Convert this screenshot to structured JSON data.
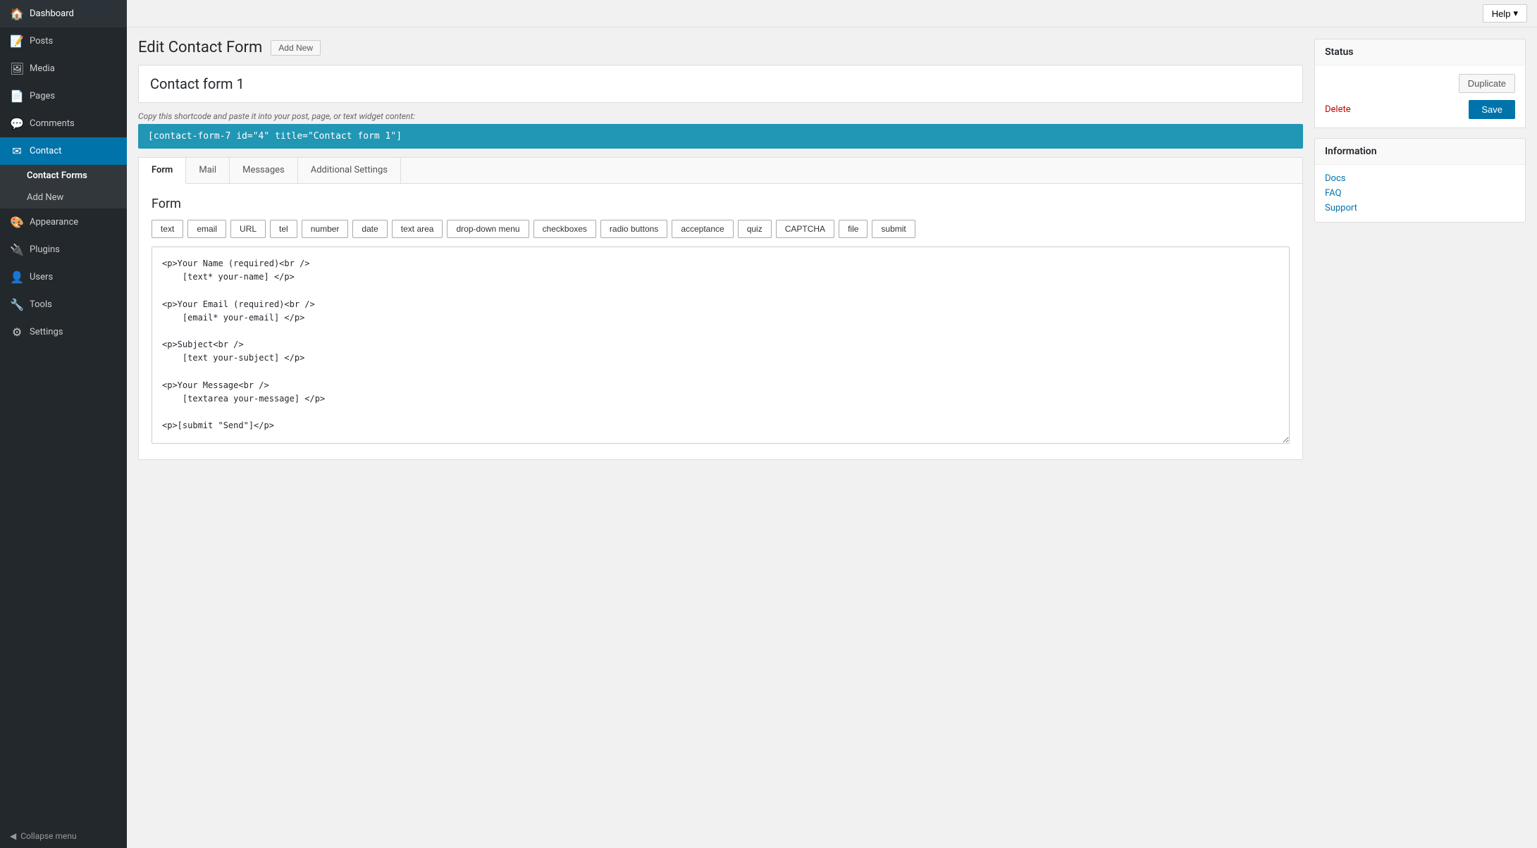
{
  "sidebar": {
    "items": [
      {
        "id": "dashboard",
        "label": "Dashboard",
        "icon": "🏠"
      },
      {
        "id": "posts",
        "label": "Posts",
        "icon": "📝"
      },
      {
        "id": "media",
        "label": "Media",
        "icon": "🖼"
      },
      {
        "id": "pages",
        "label": "Pages",
        "icon": "📄"
      },
      {
        "id": "comments",
        "label": "Comments",
        "icon": "💬"
      },
      {
        "id": "contact",
        "label": "Contact",
        "icon": "✉",
        "active": true
      },
      {
        "id": "appearance",
        "label": "Appearance",
        "icon": "🎨"
      },
      {
        "id": "plugins",
        "label": "Plugins",
        "icon": "🔌"
      },
      {
        "id": "users",
        "label": "Users",
        "icon": "👤"
      },
      {
        "id": "tools",
        "label": "Tools",
        "icon": "🔧"
      },
      {
        "id": "settings",
        "label": "Settings",
        "icon": "⚙"
      }
    ],
    "contact_submenu": [
      {
        "id": "contact-forms",
        "label": "Contact Forms",
        "active": true
      },
      {
        "id": "add-new",
        "label": "Add New"
      }
    ],
    "collapse_label": "Collapse menu"
  },
  "topbar": {
    "help_label": "Help",
    "help_arrow": "▾"
  },
  "page": {
    "title": "Edit Contact Form",
    "add_new_label": "Add New",
    "form_name": "Contact form 1",
    "shortcode_desc": "Copy this shortcode and paste it into your post, page, or text widget content:",
    "shortcode": "[contact-form-7 id=\"4\" title=\"Contact form 1\"]"
  },
  "tabs": [
    {
      "id": "form",
      "label": "Form",
      "active": true
    },
    {
      "id": "mail",
      "label": "Mail"
    },
    {
      "id": "messages",
      "label": "Messages"
    },
    {
      "id": "additional-settings",
      "label": "Additional Settings"
    }
  ],
  "form_tab": {
    "section_title": "Form",
    "field_buttons": [
      "text",
      "email",
      "URL",
      "tel",
      "number",
      "date",
      "text area",
      "drop-down menu",
      "checkboxes",
      "radio buttons",
      "acceptance",
      "quiz",
      "CAPTCHA",
      "file",
      "submit"
    ],
    "code_content": "<p>Your Name (required)<br />\n    [text* your-name] </p>\n\n<p>Your Email (required)<br />\n    [email* your-email] </p>\n\n<p>Subject<br />\n    [text your-subject] </p>\n\n<p>Your Message<br />\n    [textarea your-message] </p>\n\n<p>[submit \"Send\"]</p>"
  },
  "status_panel": {
    "title": "Status",
    "duplicate_label": "Duplicate",
    "delete_label": "Delete",
    "save_label": "Save"
  },
  "info_panel": {
    "title": "Information",
    "links": [
      {
        "label": "Docs"
      },
      {
        "label": "FAQ"
      },
      {
        "label": "Support"
      }
    ]
  }
}
